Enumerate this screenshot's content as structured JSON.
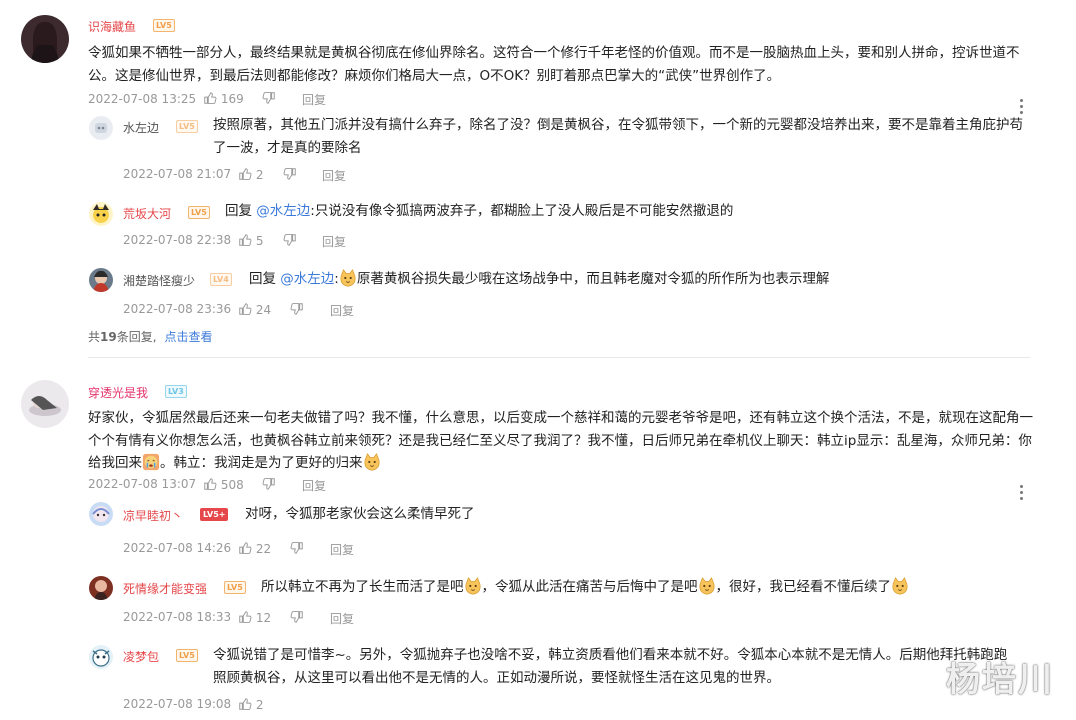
{
  "threads": [
    {
      "user": "识海藏鱼",
      "level": "LV5",
      "text": "令狐如果不牺牲一部分人，最终结果就是黄枫谷彻底在修仙界除名。这符合一个修行千年老怪的价值观。而不是一股脑热血上头，要和别人拼命，控诉世道不公。这是修仙世界，到最后法则都能修改？麻烦你们格局大一点，O不OK？别盯着那点巴掌大的“武侠”世界创作了。",
      "date": "2022-07-08 13:25",
      "likes": "169",
      "reply_label": "回复",
      "replies": [
        {
          "user": "水左边",
          "level": "LV5",
          "prefix": "",
          "mention": "",
          "text": "按照原著，其他五门派并没有搞什么弃子，除名了没？倒是黄枫谷，在令狐带领下，一个新的元婴都没培养出来，要不是靠着主角庇护苟了一波，才是真的要除名",
          "date": "2022-07-08 21:07",
          "likes": "2"
        },
        {
          "user": "荒坂大河",
          "level": "LV5",
          "prefix": "回复 ",
          "mention": "@水左边",
          "text": ":只说没有像令狐搞两波弃子，都糊脸上了没人殿后是不可能安然撤退的",
          "date": "2022-07-08 22:38",
          "likes": "5"
        },
        {
          "user": "湘楚踏怪瘦少",
          "level": "LV4",
          "prefix": "回复 ",
          "mention": "@水左边",
          "text": "原著黄枫谷损失最少哦在这场战争中，而且韩老魔对令狐的所作所为也表示理解",
          "date": "2022-07-08 23:36",
          "likes": "24"
        }
      ],
      "total_prefix": "共",
      "total_count": "19",
      "total_suffix": "条回复,",
      "view_link": "点击查看"
    },
    {
      "user": "穿透光是我",
      "level": "LV3",
      "text_a": "好家伙，令狐居然最后还来一句老夫做错了吗？我不懂，什么意思，以后变成一个慈祥和蔼的元婴老爷爷是吧，还有韩立这个换个活法，不是，就现在这配角一个个有情有义你想怎么活，也黄枫谷韩立前来领死？还是我已经仁至义尽了我润了？我不懂，日后师兄弟在牵机仪上聊天：韩立ip显示：乱星海，众师兄弟：你给我回来",
      "text_b": "。韩立：我润走是为了更好的归来",
      "date": "2022-07-08 13:07",
      "likes": "508",
      "reply_label": "回复",
      "replies": [
        {
          "user": "凉早睦初丶",
          "level": "LV5+",
          "text": "对呀，令狐那老家伙会这么柔情早死了",
          "date": "2022-07-08 14:26",
          "likes": "22"
        },
        {
          "user": "死情缘才能变强",
          "level": "LV5",
          "text_a": "所以韩立不再为了长生而活了是吧",
          "text_b": "，令狐从此活在痛苦与后悔中了是吧",
          "text_c": "，很好，我已经看不懂后续了",
          "date": "2022-07-08 18:33",
          "likes": "12"
        },
        {
          "user": "凌梦包",
          "level": "LV5",
          "text": "令狐说错了是可惜李~。另外，令狐抛弃子也没啥不妥，韩立资质看他们看来本就不好。令狐本心本就不是无情人。后期他拜托韩跑跑照顾黄枫谷，从这里可以看出他不是无情的人。正如动漫所说，要怪就怪生活在这见鬼的世界。",
          "date": "2022-07-08 19:08",
          "likes": "2"
        }
      ]
    }
  ],
  "watermark": "杨培川",
  "colors": {
    "username_red": "#e5474a",
    "mention_blue": "#3b7ad9",
    "meta_grey": "#999999"
  }
}
